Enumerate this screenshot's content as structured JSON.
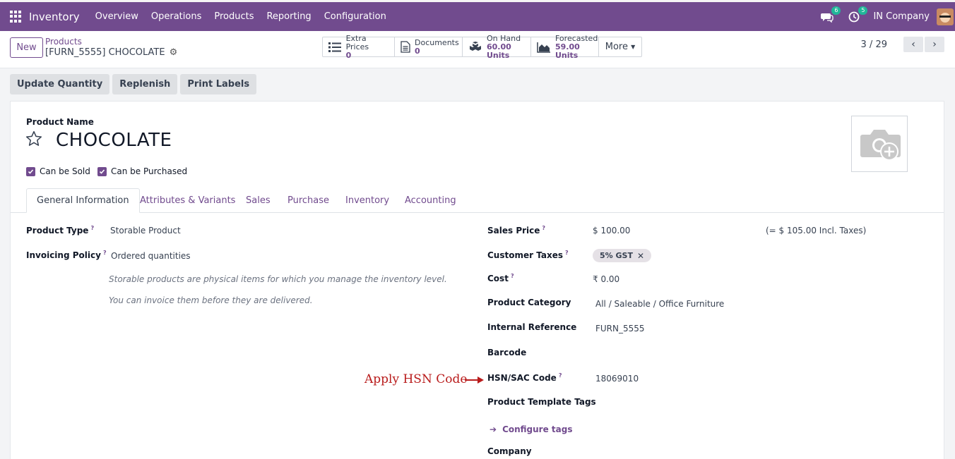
{
  "navbar": {
    "app_name": "Inventory",
    "menu": [
      "Overview",
      "Operations",
      "Products",
      "Reporting",
      "Configuration"
    ],
    "messages_badge": "6",
    "activities_badge": "5",
    "company": "IN Company",
    "icons": {
      "apps": "grid-icon",
      "messages": "chat-icon",
      "activities": "clock-icon"
    }
  },
  "control": {
    "new_label": "New",
    "breadcrumb_parent": "Products",
    "breadcrumb_current": "[FURN_5555] CHOCOLATE",
    "stats": [
      {
        "label": "Extra Prices",
        "value": "0",
        "icon": "list-icon"
      },
      {
        "label": "Documents",
        "value": "0",
        "icon": "document-icon"
      },
      {
        "label": "On Hand",
        "value": "60.00 Units",
        "icon": "cubes-icon"
      },
      {
        "label": "Forecasted",
        "value": "59.00 Units",
        "icon": "area-chart-icon"
      }
    ],
    "more_label": "More",
    "pager": "3 / 29"
  },
  "actions": {
    "update_quantity": "Update Quantity",
    "replenish": "Replenish",
    "print_labels": "Print Labels"
  },
  "form": {
    "product_name_label": "Product Name",
    "product_name": "CHOCOLATE",
    "can_be_sold": "Can be Sold",
    "can_be_purchased": "Can be Purchased",
    "tabs": [
      "General Information",
      "Attributes & Variants",
      "Sales",
      "Purchase",
      "Inventory",
      "Accounting"
    ],
    "left": {
      "product_type_label": "Product Type",
      "product_type": "Storable Product",
      "invoicing_policy_label": "Invoicing Policy",
      "invoicing_policy": "Ordered quantities",
      "help_1": "Storable products are physical items for which you manage the inventory level.",
      "help_2": "You can invoice them before they are delivered."
    },
    "right": {
      "sales_price_label": "Sales Price",
      "sales_price": "$ 100.00",
      "incl_taxes": "(= $ 105.00 Incl. Taxes)",
      "customer_taxes_label": "Customer Taxes",
      "customer_tax_tag": "5% GST",
      "cost_label": "Cost",
      "cost": "₹ 0.00",
      "product_category_label": "Product Category",
      "product_category": "All / Saleable / Office Furniture",
      "internal_reference_label": "Internal Reference",
      "internal_reference": "FURN_5555",
      "barcode_label": "Barcode",
      "hsn_label": "HSN/SAC Code",
      "hsn": "18069010",
      "template_tags_label": "Product Template Tags",
      "configure_tags": "Configure tags",
      "company_label": "Company"
    },
    "help_mark": "?"
  },
  "annotation": {
    "text": "Apply HSN Code",
    "color": "#b91c1c"
  },
  "colors": {
    "brand": "#714b8e",
    "badge": "#21b799"
  }
}
